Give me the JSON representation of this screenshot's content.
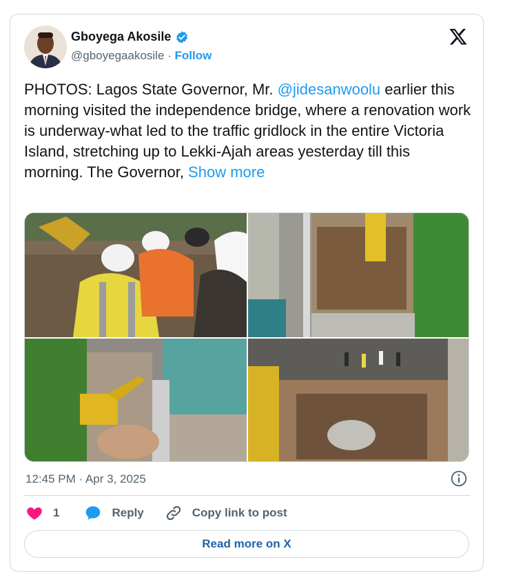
{
  "author": {
    "name": "Gboyega Akosile",
    "handle": "@gboyegaakosile",
    "separator": " · ",
    "follow_label": "Follow"
  },
  "tweet": {
    "text_before": "PHOTOS: Lagos State Governor, Mr. ",
    "mention": "@jidesanwoolu",
    "text_after": " earlier this morning visited the independence bridge, where a renovation work is underway-what led to the traffic gridlock in the entire Victoria Island, stretching up to Lekki-Ajah areas yesterday till this morning. The Governor, ",
    "show_more": "Show more"
  },
  "timestamp": "12:45 PM · Apr 3, 2025",
  "actions": {
    "like_count": "1",
    "reply_label": "Reply",
    "copy_label": "Copy link to post"
  },
  "read_more_label": "Read more on X",
  "icons": {
    "verified": "verified-badge-icon",
    "x_logo": "x-logo-icon",
    "info": "info-icon",
    "like": "heart-icon",
    "reply": "speech-bubble-icon",
    "copy": "link-icon"
  },
  "colors": {
    "link": "#1d9bf0",
    "muted": "#536471",
    "like": "#f91880",
    "border": "#cfd9de"
  }
}
